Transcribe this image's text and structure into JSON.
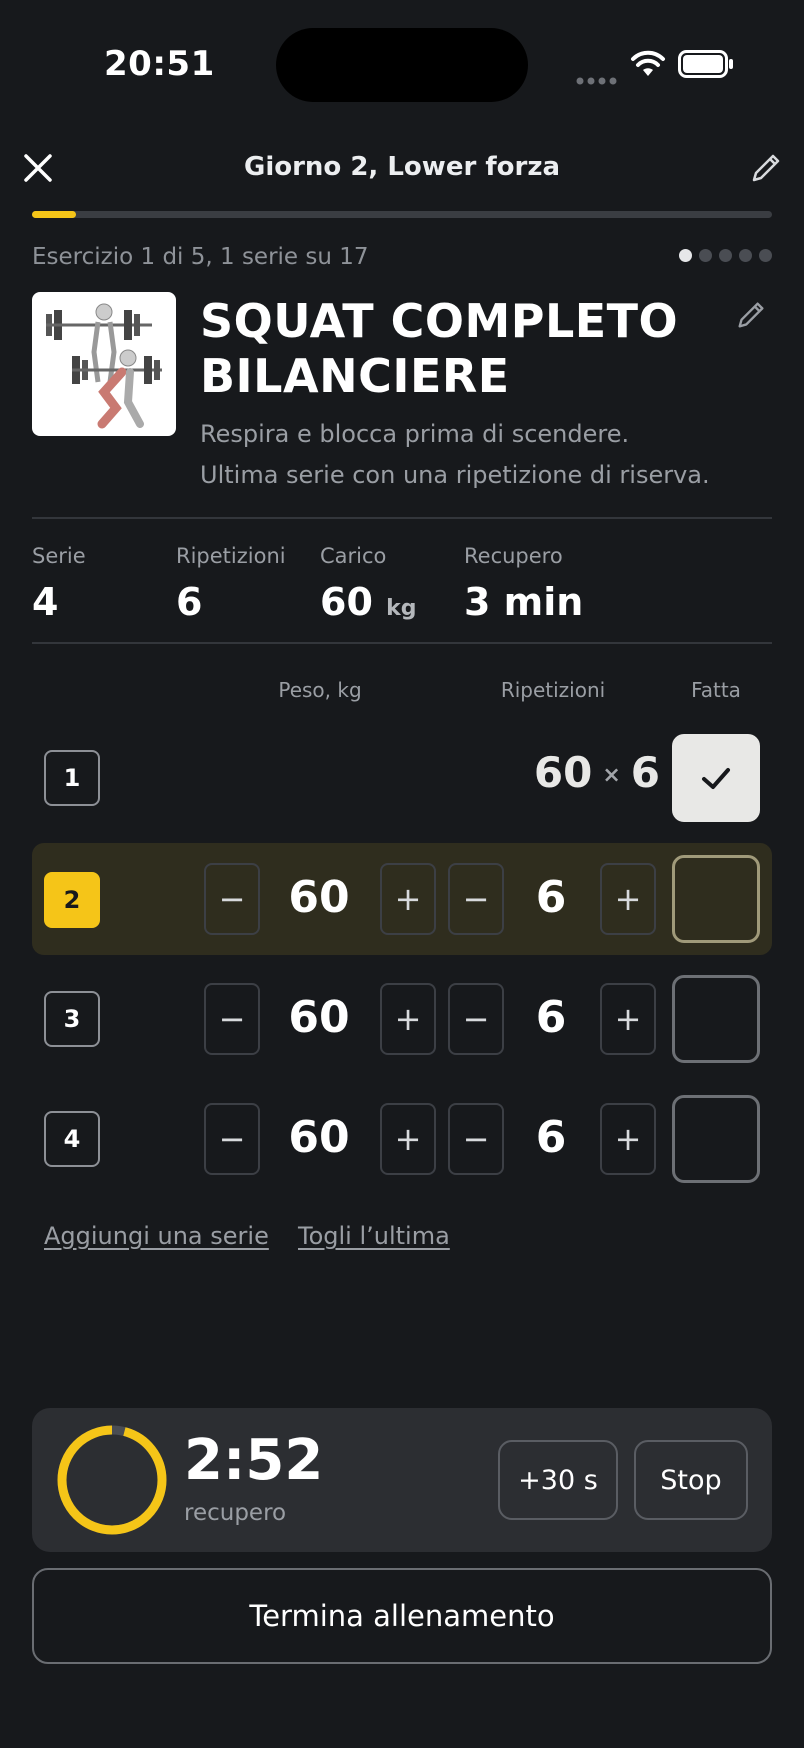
{
  "status_bar": {
    "time": "20:51"
  },
  "header": {
    "title": "Giorno 2, Lower forza"
  },
  "workout_progress": {
    "fraction": 0.06
  },
  "exercise": {
    "counter": "Esercizio 1 di 5, 1 serie su 17",
    "page_dots": 5,
    "active_dot": 1,
    "name_line1": "SQUAT COMPLETO",
    "name_line2": "BILANCIERE",
    "note_line1": "Respira e blocca prima di scendere.",
    "note_line2": "Ultima serie con una ripetizione di riserva."
  },
  "stats": [
    {
      "label": "Serie",
      "value": "4",
      "unit": ""
    },
    {
      "label": "Ripetizioni",
      "value": "6",
      "unit": ""
    },
    {
      "label": "Carico",
      "value": "60",
      "unit": "kg"
    },
    {
      "label": "Recupero",
      "value": "3 min",
      "unit": ""
    }
  ],
  "table_headers": {
    "weight": "Peso, kg",
    "reps": "Ripetizioni",
    "done": "Fatta"
  },
  "sets": [
    {
      "number": "1",
      "weight": "60",
      "reps": "6",
      "done": true,
      "current": false
    },
    {
      "number": "2",
      "weight": "60",
      "reps": "6",
      "done": false,
      "current": true
    },
    {
      "number": "3",
      "weight": "60",
      "reps": "6",
      "done": false,
      "current": false
    },
    {
      "number": "4",
      "weight": "60",
      "reps": "6",
      "done": false,
      "current": false
    }
  ],
  "completed_separator": "×",
  "stepper": {
    "minus": "−",
    "plus": "+"
  },
  "links": {
    "add_set": "Aggiungi una serie",
    "remove_last": "Togli l’ultima"
  },
  "rest_timer": {
    "time": "2:52",
    "label": "recupero",
    "add_button": "+30 s",
    "stop_button": "Stop",
    "remaining_fraction": 0.96
  },
  "finish_button": "Termina allenamento",
  "colors": {
    "accent": "#f5c518",
    "background": "#17191c",
    "card": "#2c2e32",
    "current_row": "#2f2d1e"
  }
}
